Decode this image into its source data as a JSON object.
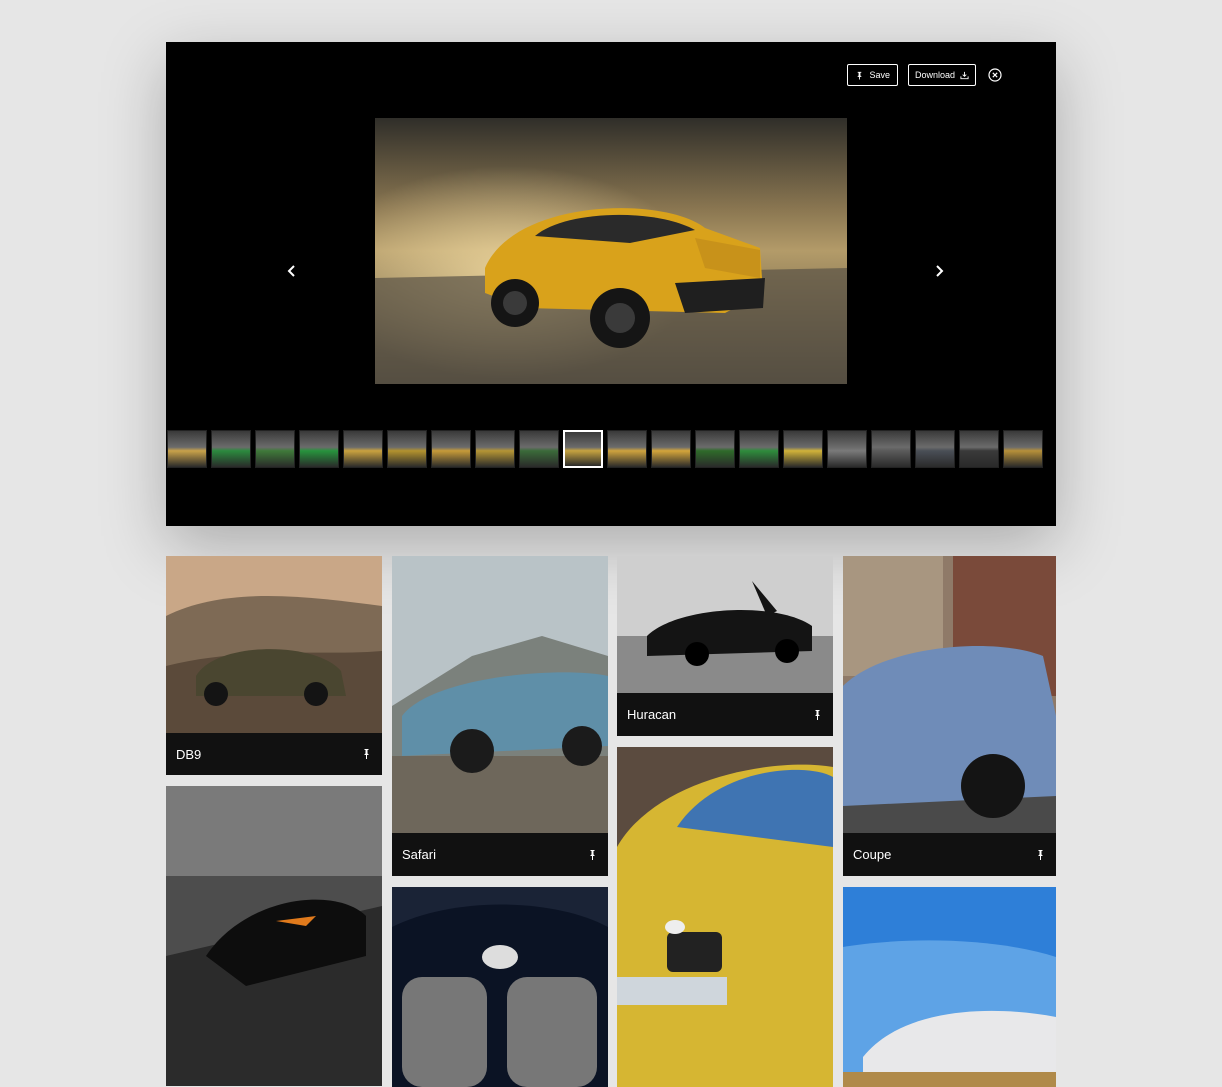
{
  "viewer": {
    "toolbar": {
      "save_label": "Save",
      "download_label": "Download",
      "save_icon": "pin-icon",
      "download_icon": "download-icon",
      "close_icon": "close-circle-icon"
    },
    "main_image": {
      "subject": "yellow SUV on desert road"
    },
    "thumbnail_count": 20,
    "active_thumbnail": 10
  },
  "gallery": {
    "cards": [
      {
        "title": "DB9"
      },
      {
        "title": "Safari"
      },
      {
        "title": "Huracan"
      },
      {
        "title": "Coupe"
      },
      {
        "title": ""
      },
      {
        "title": ""
      },
      {
        "title": ""
      },
      {
        "title": ""
      }
    ]
  },
  "colors": {
    "background": "#e6e6e6",
    "viewer_bg": "#000000",
    "caption_bg": "#111111",
    "accent_yellow": "#e0a91c"
  }
}
